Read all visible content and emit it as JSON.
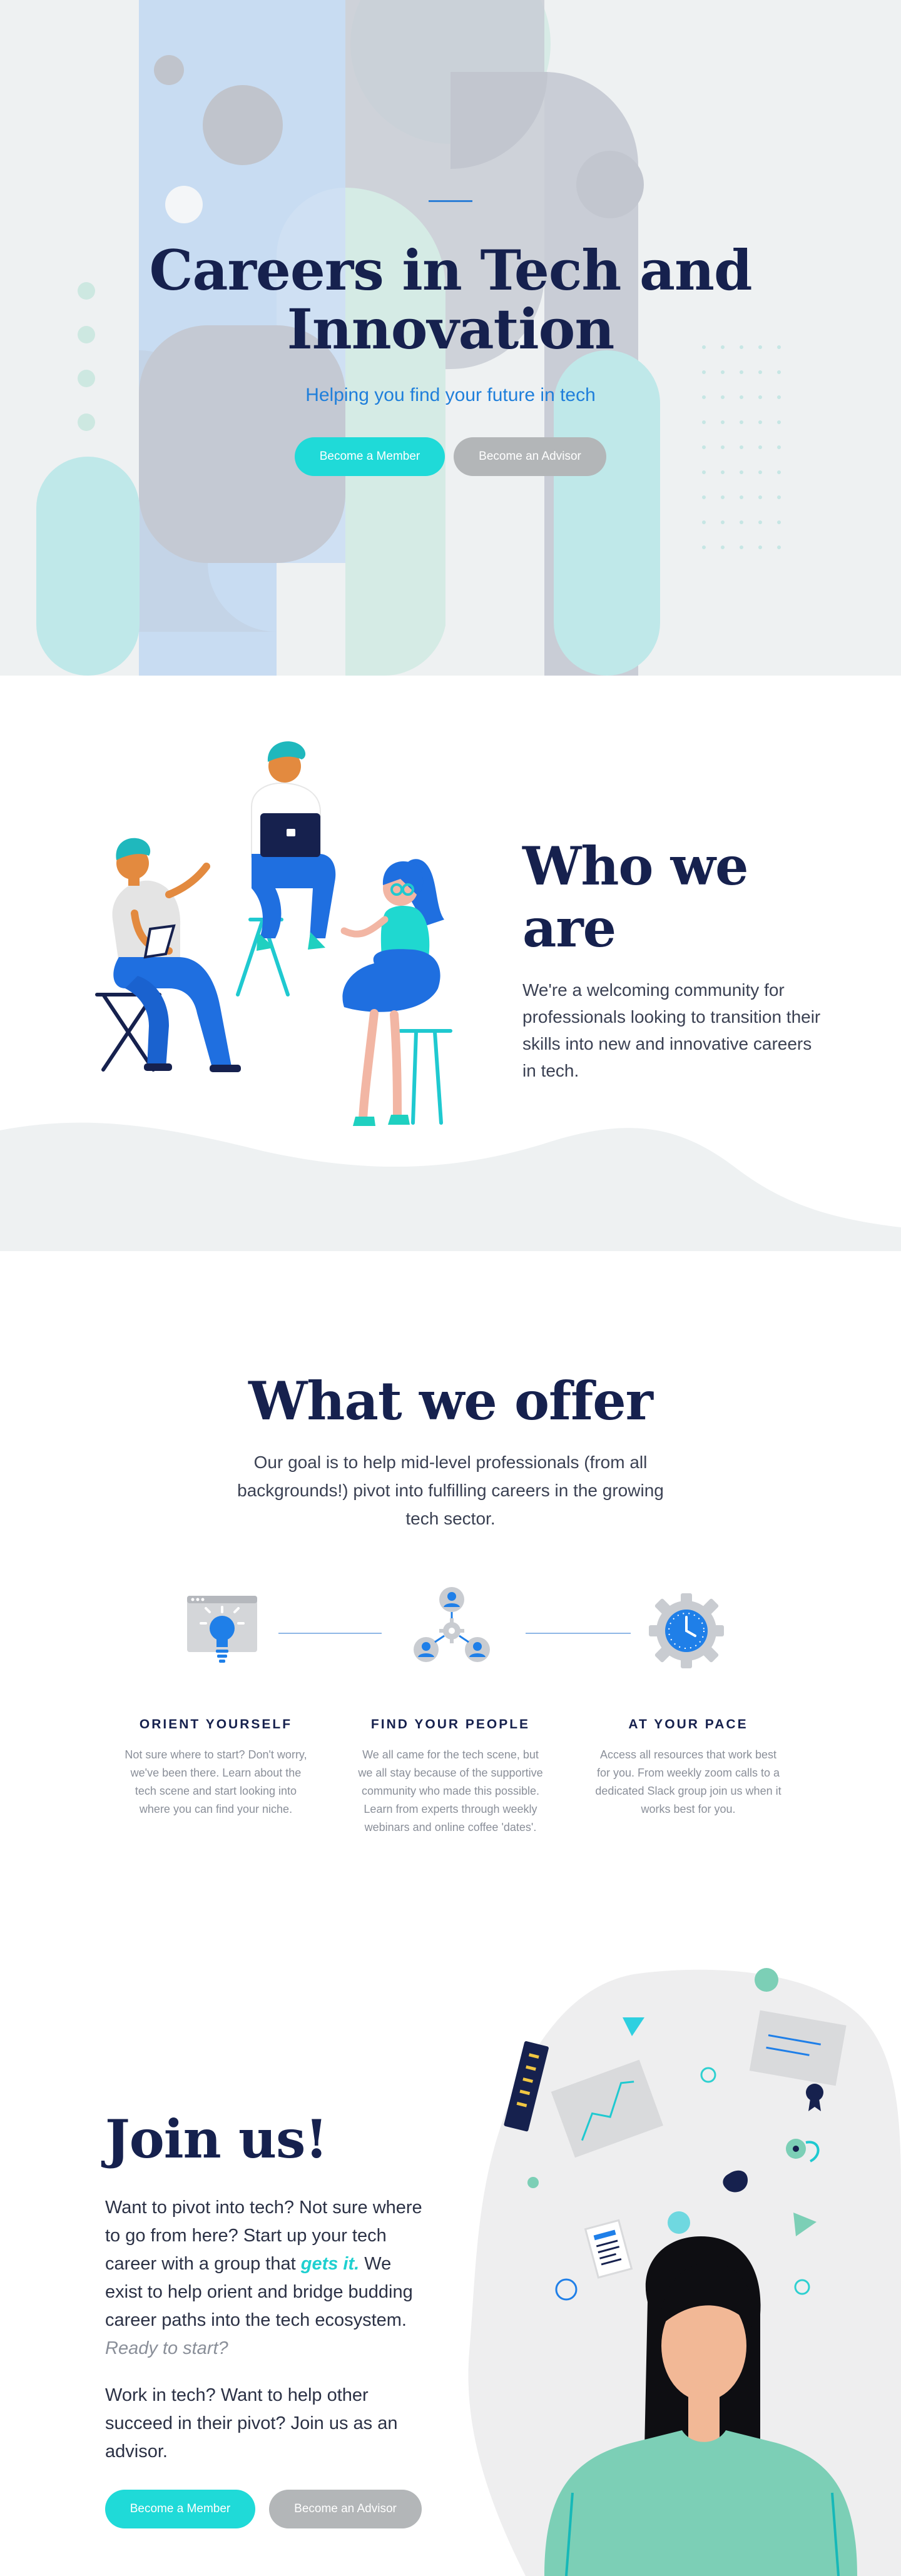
{
  "hero": {
    "title_line1": "Careers in Tech and",
    "title_line2": "Innovation",
    "subtitle": "Helping you find your future in tech",
    "member_button": "Become a Member",
    "advisor_button": "Become an Advisor"
  },
  "who": {
    "title": "Who we are",
    "body": "We're a welcoming community for professionals looking to transition their skills into new and innovative careers in tech.",
    "illustration": "people-working-on-laptops-illustration"
  },
  "offer": {
    "title": "What we offer",
    "intro": "Our goal is to help mid-level professionals (from all backgrounds!) pivot into fulfilling careers in the growing tech sector.",
    "items": [
      {
        "icon": "lightbulb-browser-icon",
        "heading": "ORIENT YOURSELF",
        "text": "Not sure where to start? Don't worry, we've been there. Learn about the tech scene and start looking into where you can find your niche."
      },
      {
        "icon": "people-network-icon",
        "heading": "FIND YOUR PEOPLE",
        "text": "We all came for the tech scene, but we all stay because of the supportive community who made this possible. Learn from experts through weekly webinars and online coffee 'dates'."
      },
      {
        "icon": "gear-clock-icon",
        "heading": "AT YOUR PACE",
        "text": "Access all resources that work best for you. From weekly zoom calls to a dedicated Slack group join us when it works best for you."
      }
    ]
  },
  "join": {
    "title": "Join us!",
    "p1_before": "Want to pivot into tech? Not sure where to go from here? Start up your tech career with a group that ",
    "p1_highlight": "gets it.",
    "p1_after": " We exist to help orient and bridge budding career paths into the tech ecosystem. ",
    "p1_italic": "Ready to start?",
    "p2": "Work in tech? Want to help other succeed in their pivot? Join us as an advisor.",
    "member_button": "Become a Member",
    "advisor_button": "Become an Advisor",
    "illustration": "woman-with-career-ideas-illustration"
  },
  "colors": {
    "navy": "#16214e",
    "teal": "#1fdad8",
    "blue": "#1f7fdb",
    "grey_button": "#b3b6b8",
    "hero_bg": "#eef1f2"
  }
}
